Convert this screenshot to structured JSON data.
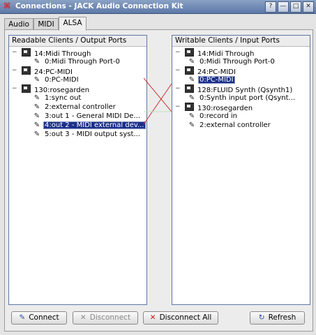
{
  "window": {
    "title": "Connections - JACK Audio Connection Kit",
    "controls": [
      "?",
      "—",
      "□",
      "✕"
    ]
  },
  "tabs": [
    {
      "label": "Audio"
    },
    {
      "label": "MIDI"
    },
    {
      "label": "ALSA",
      "active": true
    }
  ],
  "readable_panel": {
    "header": "Readable Clients / Output Ports",
    "clients": [
      {
        "label": "14:Midi Through",
        "ports": [
          {
            "label": "0:Midi Through Port-0"
          }
        ]
      },
      {
        "label": "24:PC-MIDI",
        "ports": [
          {
            "label": "0:PC-MIDI"
          }
        ]
      },
      {
        "label": "130:rosegarden",
        "ports": [
          {
            "label": "1:sync out"
          },
          {
            "label": "2:external controller"
          },
          {
            "label": "3:out 1 - General MIDI De..."
          },
          {
            "label": "4:out 2 - MIDI external dev...",
            "selected": true
          },
          {
            "label": "5:out 3 - MIDI output syst..."
          }
        ]
      }
    ]
  },
  "writable_panel": {
    "header": "Writable Clients / Input Ports",
    "clients": [
      {
        "label": "14:Midi Through",
        "ports": [
          {
            "label": "0:Midi Through Port-0"
          }
        ]
      },
      {
        "label": "24:PC-MIDI",
        "ports": [
          {
            "label": "0:PC-MIDI",
            "selected": true
          }
        ]
      },
      {
        "label": "128:FLUID Synth (Qsynth1)",
        "ports": [
          {
            "label": "0:Synth input port (Qsynt..."
          }
        ]
      },
      {
        "label": "130:rosegarden",
        "ports": [
          {
            "label": "0:record in"
          },
          {
            "label": "2:external controller"
          }
        ]
      }
    ]
  },
  "buttons": {
    "connect": "Connect",
    "disconnect": "Disconnect",
    "disconnect_all": "Disconnect All",
    "refresh": "Refresh"
  },
  "colors": {
    "selection": "#1a2f8a",
    "connection_line": "#cc3333",
    "title_bar": "#6d87b3"
  }
}
